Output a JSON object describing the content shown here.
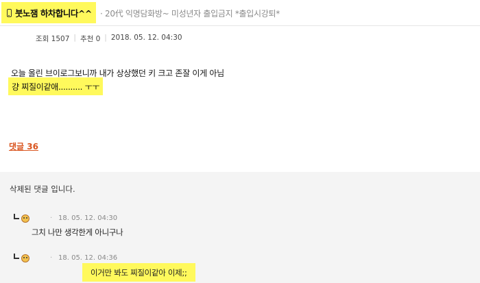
{
  "header": {
    "title": "붓노잼 하차합니다^^",
    "board": "· 20代 익명담화방~ 미성년자 출입금지 *출입시강퇴*"
  },
  "meta": {
    "views": "조회 1507",
    "likes": "추천 0",
    "date": "2018. 05. 12.  04:30"
  },
  "post": {
    "line1": "오늘 올린 브이로그보니까 내가 상상했던 키 크고 존잘 이게 아님",
    "line2": "걍 찌질이같애.......... ㅜㅜ"
  },
  "comment_count": "댓글 36",
  "comments": {
    "deleted": "삭제된 댓글 입니다.",
    "replies": [
      {
        "date": "18. 05. 12.  04:30",
        "text": "그치 나만 생각한게 아니구나"
      },
      {
        "date": "18. 05. 12.  04:36",
        "text": "이거만 봐도 찌질이같아 이제;;"
      }
    ]
  }
}
